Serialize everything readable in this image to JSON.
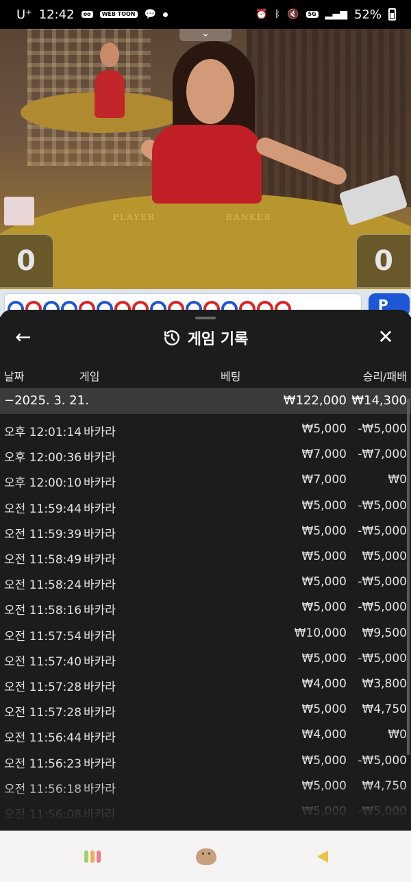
{
  "status_bar": {
    "carrier": "U⁺",
    "time": "12:42",
    "webtoon_badge": "WEB TOON",
    "network": "5G",
    "battery": "52%"
  },
  "video": {
    "felt_player": "PLAYER",
    "felt_banker": "BANKER",
    "player_score": "0",
    "banker_score": "0",
    "collapse_glyph": "⌄"
  },
  "road": {
    "button_label": "P",
    "beads": [
      "blue",
      "red",
      "blue",
      "blue",
      "red",
      "blue",
      "red",
      "red",
      "blue",
      "red",
      "blue",
      "red",
      "blue",
      "red",
      "red",
      "red"
    ]
  },
  "sheet": {
    "title": "게임 기록",
    "back_glyph": "←",
    "close_glyph": "✕",
    "columns": {
      "date": "날짜",
      "game": "게임",
      "bet": "베팅",
      "result": "승리/패배"
    },
    "date_group": {
      "label": "−2025. 3. 21.",
      "total_bet": "₩122,000",
      "total_result": "₩14,300"
    },
    "rows": [
      {
        "time": "오후 12:01:14",
        "game": "바카라",
        "bet": "₩5,000",
        "result": "-₩5,000"
      },
      {
        "time": "오후 12:00:36",
        "game": "바카라",
        "bet": "₩7,000",
        "result": "-₩7,000"
      },
      {
        "time": "오후 12:00:10",
        "game": "바카라",
        "bet": "₩7,000",
        "result": "₩0"
      },
      {
        "time": "오전 11:59:44",
        "game": "바카라",
        "bet": "₩5,000",
        "result": "-₩5,000"
      },
      {
        "time": "오전 11:59:39",
        "game": "바카라",
        "bet": "₩5,000",
        "result": "-₩5,000"
      },
      {
        "time": "오전 11:58:49",
        "game": "바카라",
        "bet": "₩5,000",
        "result": "₩5,000"
      },
      {
        "time": "오전 11:58:24",
        "game": "바카라",
        "bet": "₩5,000",
        "result": "-₩5,000"
      },
      {
        "time": "오전 11:58:16",
        "game": "바카라",
        "bet": "₩5,000",
        "result": "-₩5,000"
      },
      {
        "time": "오전 11:57:54",
        "game": "바카라",
        "bet": "₩10,000",
        "result": "₩9,500"
      },
      {
        "time": "오전 11:57:40",
        "game": "바카라",
        "bet": "₩5,000",
        "result": "-₩5,000"
      },
      {
        "time": "오전 11:57:28",
        "game": "바카라",
        "bet": "₩4,000",
        "result": "₩3,800"
      },
      {
        "time": "오전 11:57:28",
        "game": "바카라",
        "bet": "₩5,000",
        "result": "₩4,750"
      },
      {
        "time": "오전 11:56:44",
        "game": "바카라",
        "bet": "₩4,000",
        "result": "₩0"
      },
      {
        "time": "오전 11:56:23",
        "game": "바카라",
        "bet": "₩5,000",
        "result": "-₩5,000"
      },
      {
        "time": "오전 11:56:18",
        "game": "바카라",
        "bet": "₩5,000",
        "result": "₩4,750"
      },
      {
        "time": "오전 11:56:08",
        "game": "바카라",
        "bet": "₩5,000",
        "result": "-₩5,000"
      }
    ]
  },
  "navbar": {
    "recent_apps_colors": [
      "#9fd36a",
      "#f0a860",
      "#f07c8c"
    ],
    "home_icon": "dog-face-icon",
    "back_color": "#e8c346"
  }
}
